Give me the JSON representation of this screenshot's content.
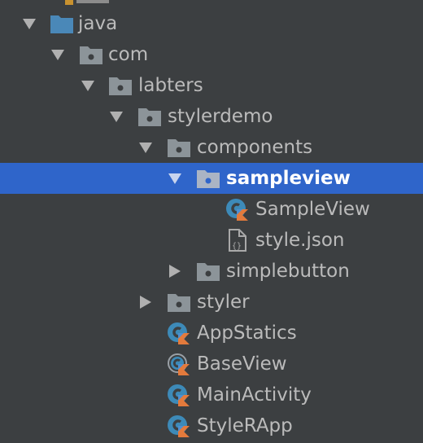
{
  "colors": {
    "background": "#3c3f41",
    "selection": "#2f65ca",
    "text": "#bbbbbb",
    "selected_text": "#ffffff",
    "folder": "#8c9499",
    "source_folder": "#4a88b8",
    "class_badge": "#3d8ab8",
    "kotlin_badge": "#e37a3c"
  },
  "tree": {
    "nodes": [
      {
        "label": "java",
        "icon": "source-folder-icon",
        "state": "expanded"
      },
      {
        "label": "com",
        "icon": "package-icon",
        "state": "expanded"
      },
      {
        "label": "labters",
        "icon": "package-icon",
        "state": "expanded"
      },
      {
        "label": "stylerdemo",
        "icon": "package-icon",
        "state": "expanded"
      },
      {
        "label": "components",
        "icon": "package-icon",
        "state": "expanded"
      },
      {
        "label": "sampleview",
        "icon": "package-icon",
        "state": "expanded",
        "selected": true
      },
      {
        "label": "SampleView",
        "icon": "kotlin-class-icon"
      },
      {
        "label": "style.json",
        "icon": "json-file-icon"
      },
      {
        "label": "simplebutton",
        "icon": "package-icon",
        "state": "collapsed"
      },
      {
        "label": "styler",
        "icon": "package-icon",
        "state": "collapsed"
      },
      {
        "label": "AppStatics",
        "icon": "kotlin-class-icon"
      },
      {
        "label": "BaseView",
        "icon": "kotlin-abstract-class-icon"
      },
      {
        "label": "MainActivity",
        "icon": "kotlin-class-icon"
      },
      {
        "label": "StyleRApp",
        "icon": "kotlin-class-icon"
      }
    ]
  }
}
